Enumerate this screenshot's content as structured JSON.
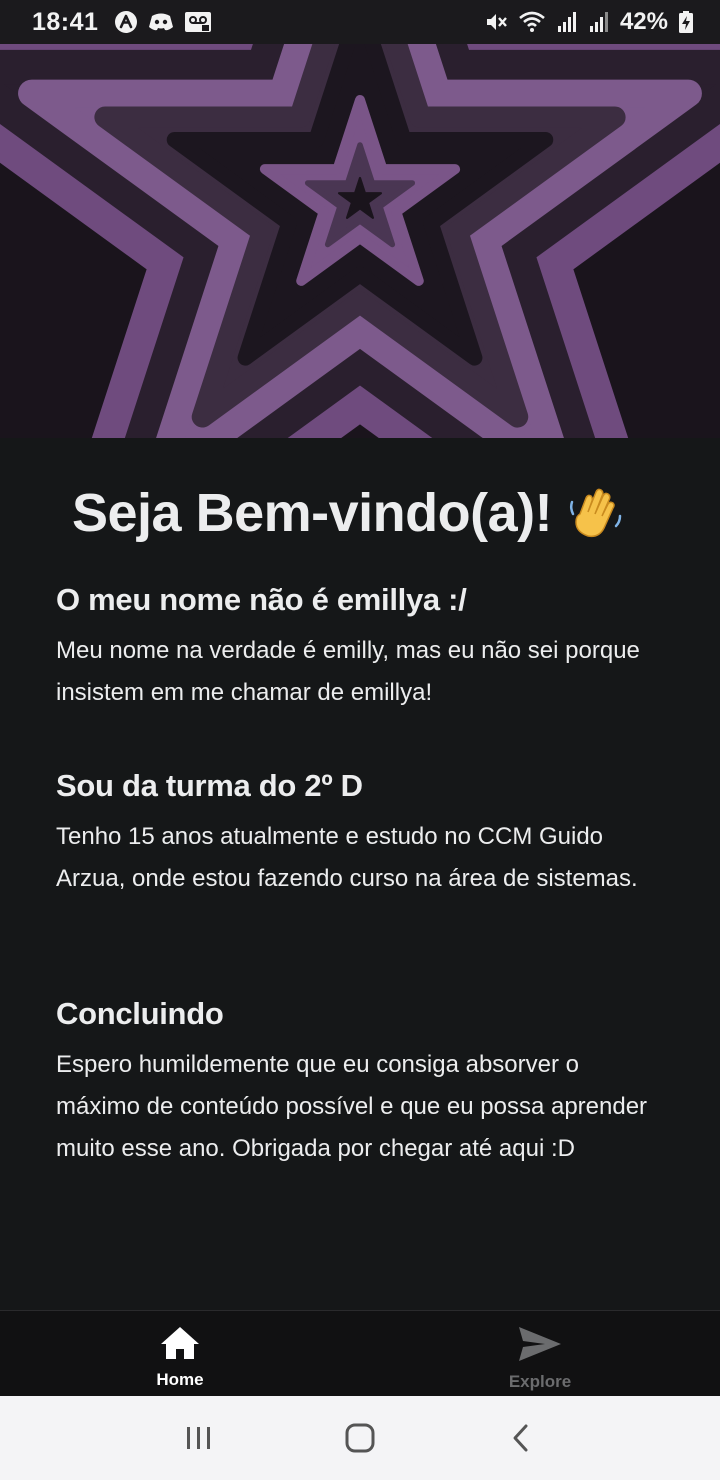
{
  "status_bar": {
    "time": "18:41",
    "battery_percent": "42%",
    "icons": [
      "app-a-icon",
      "discord-icon",
      "voicemail-icon",
      "mute-icon",
      "wifi-icon",
      "signal-icon",
      "signal-icon-2",
      "battery-charging-icon"
    ]
  },
  "header": {
    "image": "purple-concentric-stars",
    "colors": {
      "dark": "#1a141c",
      "mid": "#3c2d41",
      "purple": "#6f4b7e",
      "light": "#7d5a8c"
    }
  },
  "welcome": {
    "title": "Seja Bem-vindo(a)!",
    "emoji_icon": "waving-hand-icon"
  },
  "sections": [
    {
      "heading": "O meu nome não é emillya :/",
      "body": "Meu nome na verdade é emilly, mas eu não sei porque insistem em me chamar de emillya!"
    },
    {
      "heading": "Sou da turma do 2º D",
      "body": "Tenho 15 anos atualmente e estudo no CCM Guido Arzua, onde estou fazendo curso na área de sistemas."
    },
    {
      "heading": "Concluindo",
      "body": "Espero humildemente que eu consiga absorver o máximo de conteúdo possível e que eu possa aprender muito esse ano. Obrigada por chegar até aqui :D"
    }
  ],
  "tabbar": {
    "tabs": [
      {
        "label": "Home",
        "icon": "home-icon",
        "active": true
      },
      {
        "label": "Explore",
        "icon": "paper-plane-icon",
        "active": false
      }
    ]
  },
  "navbar": {
    "buttons": [
      "recents-button",
      "home-button",
      "back-button"
    ]
  }
}
